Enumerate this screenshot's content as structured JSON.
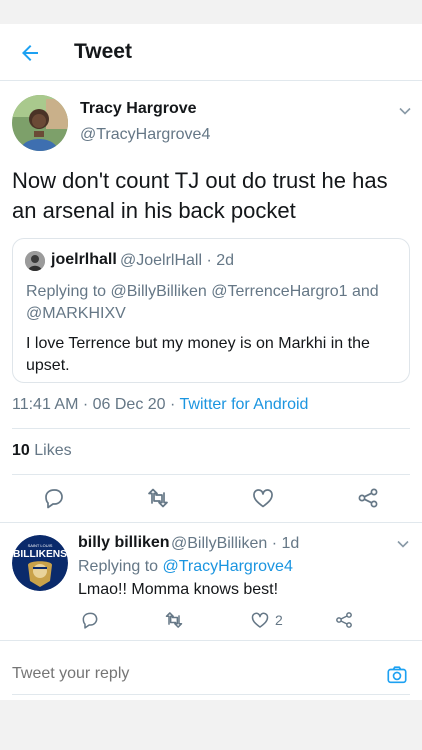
{
  "header": {
    "title": "Tweet"
  },
  "tweet": {
    "author_name": "Tracy Hargrove",
    "author_handle": "@TracyHargrove4",
    "text": "Now don't count TJ out do trust he has an arsenal in his back pocket",
    "time": "11:41 AM · 06 Dec 20 · ",
    "source": "Twitter for Android",
    "likes_count": "10",
    "likes_label": " Likes"
  },
  "quoted": {
    "name": "joelrlhall",
    "meta": "@JoelrlHall · 2d",
    "replying": "Replying to @BillyBilliken @TerrenceHargro1 and @MARKHIXV",
    "text": "I love Terrence but my money is on Markhi in the upset."
  },
  "reply": {
    "name": "billy billiken",
    "meta": "@BillyBilliken · 1d",
    "replying_prefix": "Replying to ",
    "replying_handle": "@TracyHargrove4",
    "text": "Lmao!! Momma knows best!",
    "like_count": "2",
    "avatar_text": "BILLIKENS",
    "avatar_small_text": "SAINT LOUIS"
  },
  "compose": {
    "placeholder": "Tweet your reply"
  },
  "colors": {
    "accent": "#1b95e0",
    "secondary": "#657786",
    "text": "#14171a"
  },
  "icons": [
    "back-arrow-icon",
    "chevron-down-icon",
    "reply-icon",
    "retweet-icon",
    "like-icon",
    "share-icon",
    "camera-icon"
  ]
}
